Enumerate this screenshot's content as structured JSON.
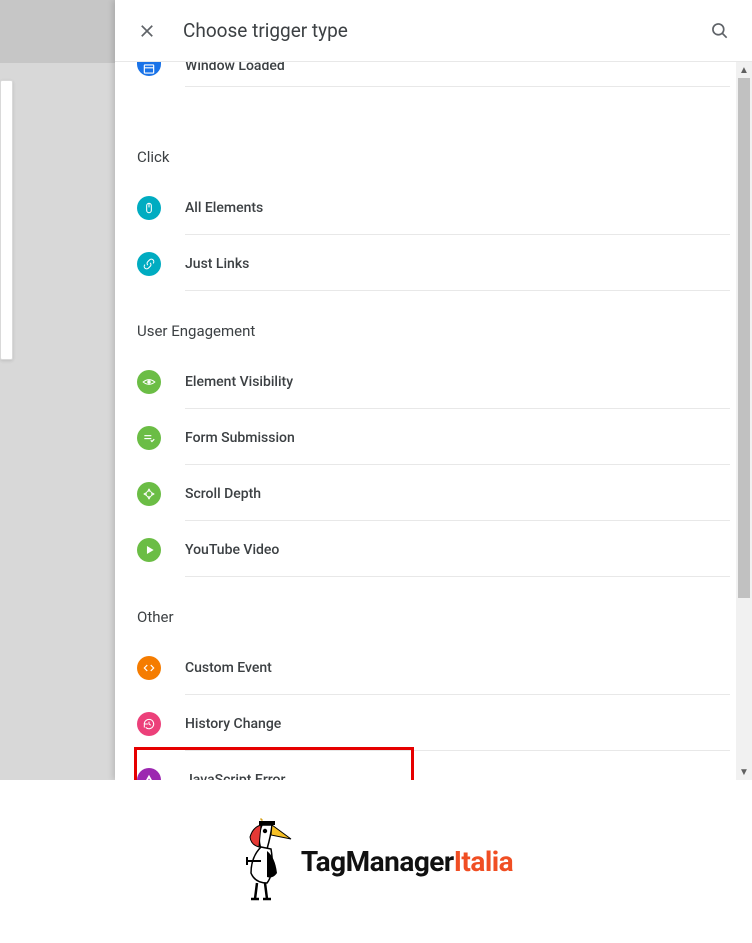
{
  "header": {
    "title": "Choose trigger type"
  },
  "partialTop": {
    "label": "Window Loaded",
    "iconName": "window-loaded-icon",
    "iconColor": "ic-blue"
  },
  "sections": [
    {
      "title": "Click",
      "items": [
        {
          "label": "All Elements",
          "iconName": "mouse-icon",
          "iconColor": "ic-cyan",
          "svg": "mouse"
        },
        {
          "label": "Just Links",
          "iconName": "link-icon",
          "iconColor": "ic-cyan",
          "svg": "link"
        }
      ]
    },
    {
      "title": "User Engagement",
      "items": [
        {
          "label": "Element Visibility",
          "iconName": "eye-icon",
          "iconColor": "ic-green",
          "svg": "eye"
        },
        {
          "label": "Form Submission",
          "iconName": "form-icon",
          "iconColor": "ic-green",
          "svg": "form"
        },
        {
          "label": "Scroll Depth",
          "iconName": "scroll-icon",
          "iconColor": "ic-green",
          "svg": "scroll"
        },
        {
          "label": "YouTube Video",
          "iconName": "play-icon",
          "iconColor": "ic-green",
          "svg": "play"
        }
      ]
    },
    {
      "title": "Other",
      "items": [
        {
          "label": "Custom Event",
          "iconName": "code-icon",
          "iconColor": "ic-orange",
          "svg": "code"
        },
        {
          "label": "History Change",
          "iconName": "history-icon",
          "iconColor": "ic-pink",
          "svg": "history"
        },
        {
          "label": "JavaScript Error",
          "iconName": "error-icon",
          "iconColor": "ic-purple",
          "svg": "error",
          "highlighted": true
        }
      ]
    }
  ],
  "footer": {
    "brand_part1": "TagManager",
    "brand_part2": "Italia"
  }
}
